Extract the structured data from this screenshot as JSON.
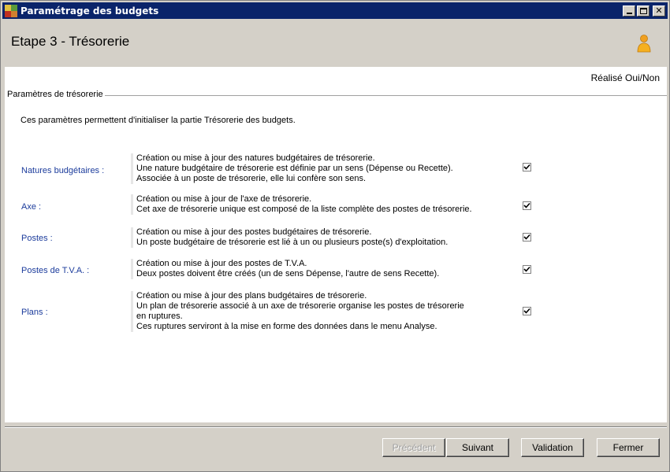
{
  "window": {
    "title": "Paramétrage des budgets"
  },
  "header": {
    "title": "Etape 3 - Trésorerie"
  },
  "content": {
    "realise_header": "Réalisé Oui/Non",
    "group_label": "Paramètres de trésorerie",
    "intro": "Ces paramètres permettent d'initialiser la partie Trésorerie des budgets.",
    "rows": [
      {
        "label": "Natures budgétaires :",
        "lines": [
          "Création ou mise à jour des natures budgétaires de trésorerie.",
          "Une nature budgétaire de trésorerie est définie par un sens (Dépense ou Recette).",
          "Associée à un poste de trésorerie, elle lui confère son sens."
        ],
        "checked": true
      },
      {
        "label": "Axe :",
        "lines": [
          "Création ou mise à jour de l'axe de trésorerie.",
          "Cet axe de trésorerie unique est composé de la liste complète des postes de trésorerie."
        ],
        "checked": true
      },
      {
        "label": "Postes :",
        "lines": [
          "Création ou mise à jour des postes budgétaires de trésorerie.",
          "Un poste budgétaire de trésorerie est lié à un ou plusieurs poste(s) d'exploitation."
        ],
        "checked": true
      },
      {
        "label": "Postes de T.V.A. :",
        "lines": [
          "Création ou mise à jour des postes de T.V.A.",
          "Deux postes doivent être créés (un de sens Dépense, l'autre de sens Recette)."
        ],
        "checked": true
      },
      {
        "label": "Plans :",
        "lines": [
          "Création ou mise à jour des plans budgétaires de trésorerie.",
          "Un plan de trésorerie associé à un axe de trésorerie organise les postes de trésorerie",
          "en ruptures.",
          "Ces ruptures serviront à la mise en forme des données dans le menu Analyse."
        ],
        "checked": true
      }
    ]
  },
  "buttons": {
    "previous": "Précédent",
    "next": "Suivant",
    "validation": "Validation",
    "close": "Fermer"
  },
  "icons": {
    "app": "app-icon",
    "user": "user-icon",
    "minimize": "minimize-icon",
    "maximize": "maximize-icon",
    "close": "close-icon"
  }
}
